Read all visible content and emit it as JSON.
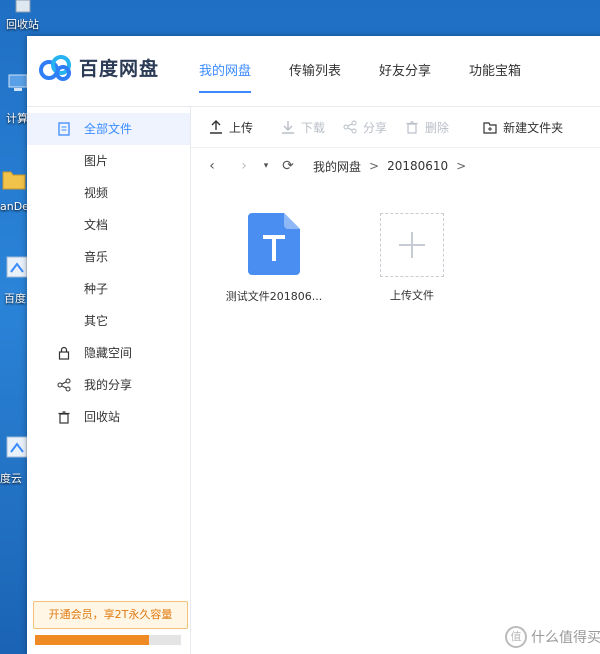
{
  "desktop": {
    "recycle_label": "回收站",
    "computer_label": "计算",
    "folder_label": "anDe",
    "shortcut1_label": "百度",
    "shortcut2_label": "度云"
  },
  "app": {
    "logo_text": "百度网盘",
    "nav_tabs": [
      {
        "label": "我的网盘",
        "active": true
      },
      {
        "label": "传输列表"
      },
      {
        "label": "好友分享"
      },
      {
        "label": "功能宝箱"
      }
    ]
  },
  "sidebar": {
    "items": [
      {
        "label": "全部文件",
        "active": true
      },
      {
        "label": "图片"
      },
      {
        "label": "视频"
      },
      {
        "label": "文档"
      },
      {
        "label": "音乐"
      },
      {
        "label": "种子"
      },
      {
        "label": "其它"
      },
      {
        "label": "隐藏空间"
      },
      {
        "label": "我的分享"
      },
      {
        "label": "回收站"
      }
    ],
    "promo_text": "开通会员，享2T永久容量",
    "storage_used_fraction": 0.78
  },
  "toolbar": {
    "upload": "上传",
    "download": "下载",
    "share": "分享",
    "delete": "删除",
    "new_folder": "新建文件夹"
  },
  "pathbar": {
    "crumbs": [
      "我的网盘",
      "20180610"
    ],
    "separator": ">"
  },
  "files": [
    {
      "name": "测试文件201806...",
      "type": "text-file"
    },
    {
      "name": "上传文件",
      "type": "upload-tile"
    }
  ],
  "watermark": {
    "text": "什么值得买",
    "symbol": "值"
  },
  "colors": {
    "accent": "#3b8cff",
    "promo_text": "#e07a10",
    "progress": "#f08a24",
    "desktop_bg": "#2b84d8"
  }
}
